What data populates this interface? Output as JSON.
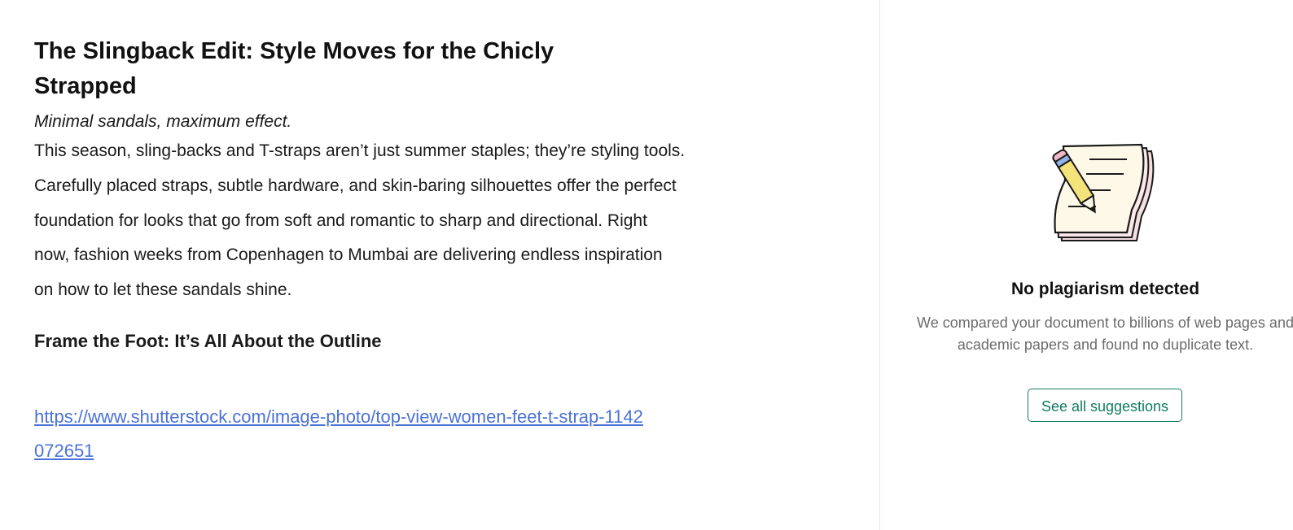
{
  "document": {
    "title": "The Slingback Edit: Style Moves for the Chicly Strapped",
    "subtitle": "Minimal sandals, maximum effect.",
    "paragraph": "This season, sling-backs and T-straps aren’t just summer staples; they’re styling tools. Carefully placed straps, subtle hardware, and skin-baring silhouettes offer the perfect foundation for looks that go from soft and romantic to sharp and directional. Right now, fashion weeks from Copenhagen to Mumbai are delivering endless inspiration on how to let these sandals shine.",
    "heading": "Frame the Foot: It’s All About the Outline",
    "link": "https://www.shutterstock.com/image-photo/top-view-women-feet-t-strap-1142072651"
  },
  "panel": {
    "illustration_icon": "notebook-pencil-icon",
    "title": "No plagiarism detected",
    "description": "We compared your document to billions of web pages and academic papers and found no duplicate text.",
    "button_label": "See all suggestions"
  },
  "colors": {
    "link": "#4a72d6",
    "accent": "#0f7a62",
    "divider": "#e6e6e6"
  }
}
